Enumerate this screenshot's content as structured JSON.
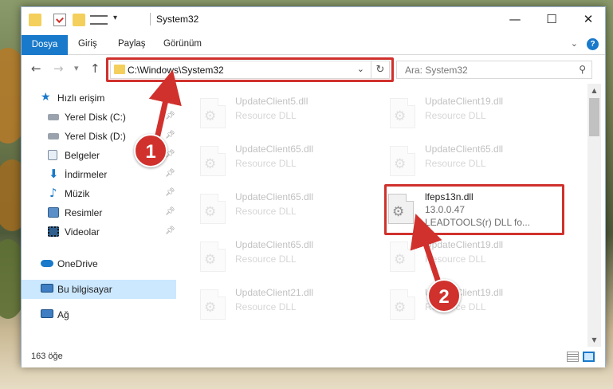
{
  "window": {
    "title": "System32",
    "controls": {
      "minimize": "—",
      "maximize": "☐",
      "close": "✕"
    }
  },
  "ribbon": {
    "tabs": [
      "Dosya",
      "Giriş",
      "Paylaş",
      "Görünüm"
    ],
    "expand_icon": "chevron-down-icon",
    "help": "?"
  },
  "navigation": {
    "back": "←",
    "forward": "→",
    "recent": "▾",
    "up": "↑",
    "address": "C:\\Windows\\System32",
    "address_dropdown": "⌄",
    "refresh": "↻",
    "search_placeholder": "Ara: System32",
    "search_icon": "⚲"
  },
  "sidebar": {
    "items": [
      {
        "label": "Hızlı erişim",
        "icon": "star-icon",
        "pinned": false
      },
      {
        "label": "Yerel Disk (C:)",
        "icon": "drive-icon",
        "pinned": true
      },
      {
        "label": "Yerel Disk (D:)",
        "icon": "drive-icon",
        "pinned": true
      },
      {
        "label": "Belgeler",
        "icon": "documents-icon",
        "pinned": true
      },
      {
        "label": "İndirmeler",
        "icon": "download-icon",
        "pinned": true
      },
      {
        "label": "Müzik",
        "icon": "music-icon",
        "pinned": true
      },
      {
        "label": "Resimler",
        "icon": "pictures-icon",
        "pinned": true
      },
      {
        "label": "Videolar",
        "icon": "videos-icon",
        "pinned": true
      },
      {
        "label": "OneDrive",
        "icon": "cloud-icon",
        "pinned": false
      },
      {
        "label": "Bu bilgisayar",
        "icon": "computer-icon",
        "pinned": false,
        "selected": true
      },
      {
        "label": "Ağ",
        "icon": "network-icon",
        "pinned": false
      }
    ]
  },
  "files": [
    {
      "name": "UpdateClient5.dll",
      "type": "Resource DLL"
    },
    {
      "name": "UpdateClient19.dll",
      "type": "Resource DLL"
    },
    {
      "name": "UpdateClient65.dll",
      "type": "Resource DLL"
    },
    {
      "name": "UpdateClient65.dll",
      "type": "Resource DLL"
    },
    {
      "name": "UpdateClient65.dll",
      "type": "Resource DLL"
    },
    {
      "name": "lfeps13n.dll",
      "version": "13.0.0.47",
      "description": "LEADTOOLS(r) DLL fo...",
      "highlighted": true
    },
    {
      "name": "UpdateClient65.dll",
      "type": "Resource DLL"
    },
    {
      "name": "UpdateClient19.dll",
      "type": "Resource DLL"
    },
    {
      "name": "UpdateClient21.dll",
      "type": "Resource DLL"
    },
    {
      "name": "UpdateClient19.dll",
      "type": "Resource DLL"
    }
  ],
  "status": {
    "item_count": "163 öğe"
  },
  "annotations": {
    "badge_1": "1",
    "badge_2": "2",
    "color": "#d0312d"
  }
}
